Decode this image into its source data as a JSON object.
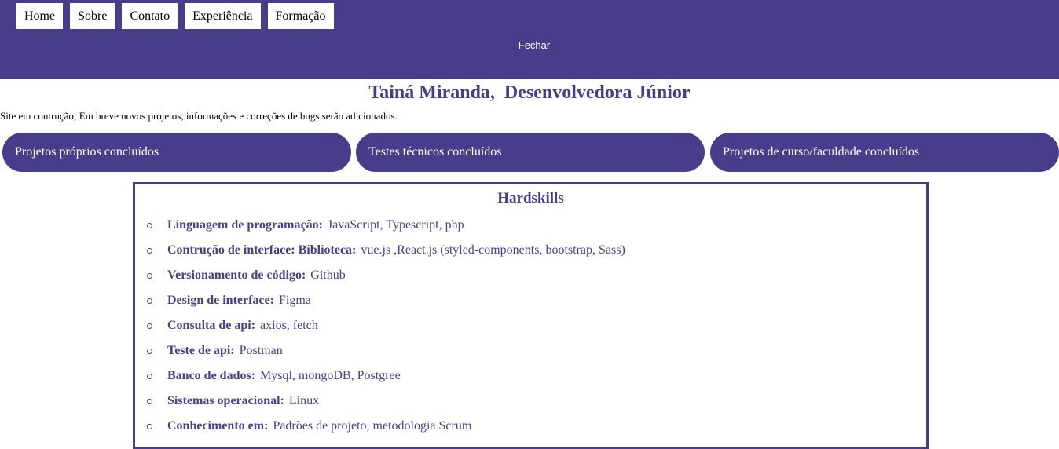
{
  "nav": {
    "items": [
      "Home",
      "Sobre",
      "Contato",
      "Experiência",
      "Formação"
    ],
    "close_label": "Fechar"
  },
  "header": {
    "title": "Tainá Miranda,  Desenvolvedora Júnior",
    "notice": "Site em contrução; Em breve novos projetos, informações e correções de bugs serão adicionados."
  },
  "categories": [
    "Projetos próprios concluídos",
    "Testes técnicos concluídos",
    "Projetos de curso/faculdade concluídos"
  ],
  "hardskills": {
    "title": "Hardskills",
    "items": [
      {
        "label": "Linguagem de programação:",
        "value": "JavaScript, Typescript, php"
      },
      {
        "label": "Contrução de interface: Biblioteca:",
        "value": "vue.js ,React.js (styled-components, bootstrap, Sass)"
      },
      {
        "label": "Versionamento de código:",
        "value": "Github"
      },
      {
        "label": "Design de interface:",
        "value": "Figma"
      },
      {
        "label": "Consulta de api:",
        "value": "axios, fetch"
      },
      {
        "label": "Teste de api:",
        "value": "Postman"
      },
      {
        "label": "Banco de dados:",
        "value": "Mysql, mongoDB, Postgree"
      },
      {
        "label": "Sistemas operacional:",
        "value": "Linux"
      },
      {
        "label": "Conhecimento em:",
        "value": "Padrões de projeto, metodologia Scrum"
      }
    ]
  },
  "colors": {
    "brand": "#483D8B",
    "text_light": "#ffffff",
    "text_dark": "#000000"
  }
}
